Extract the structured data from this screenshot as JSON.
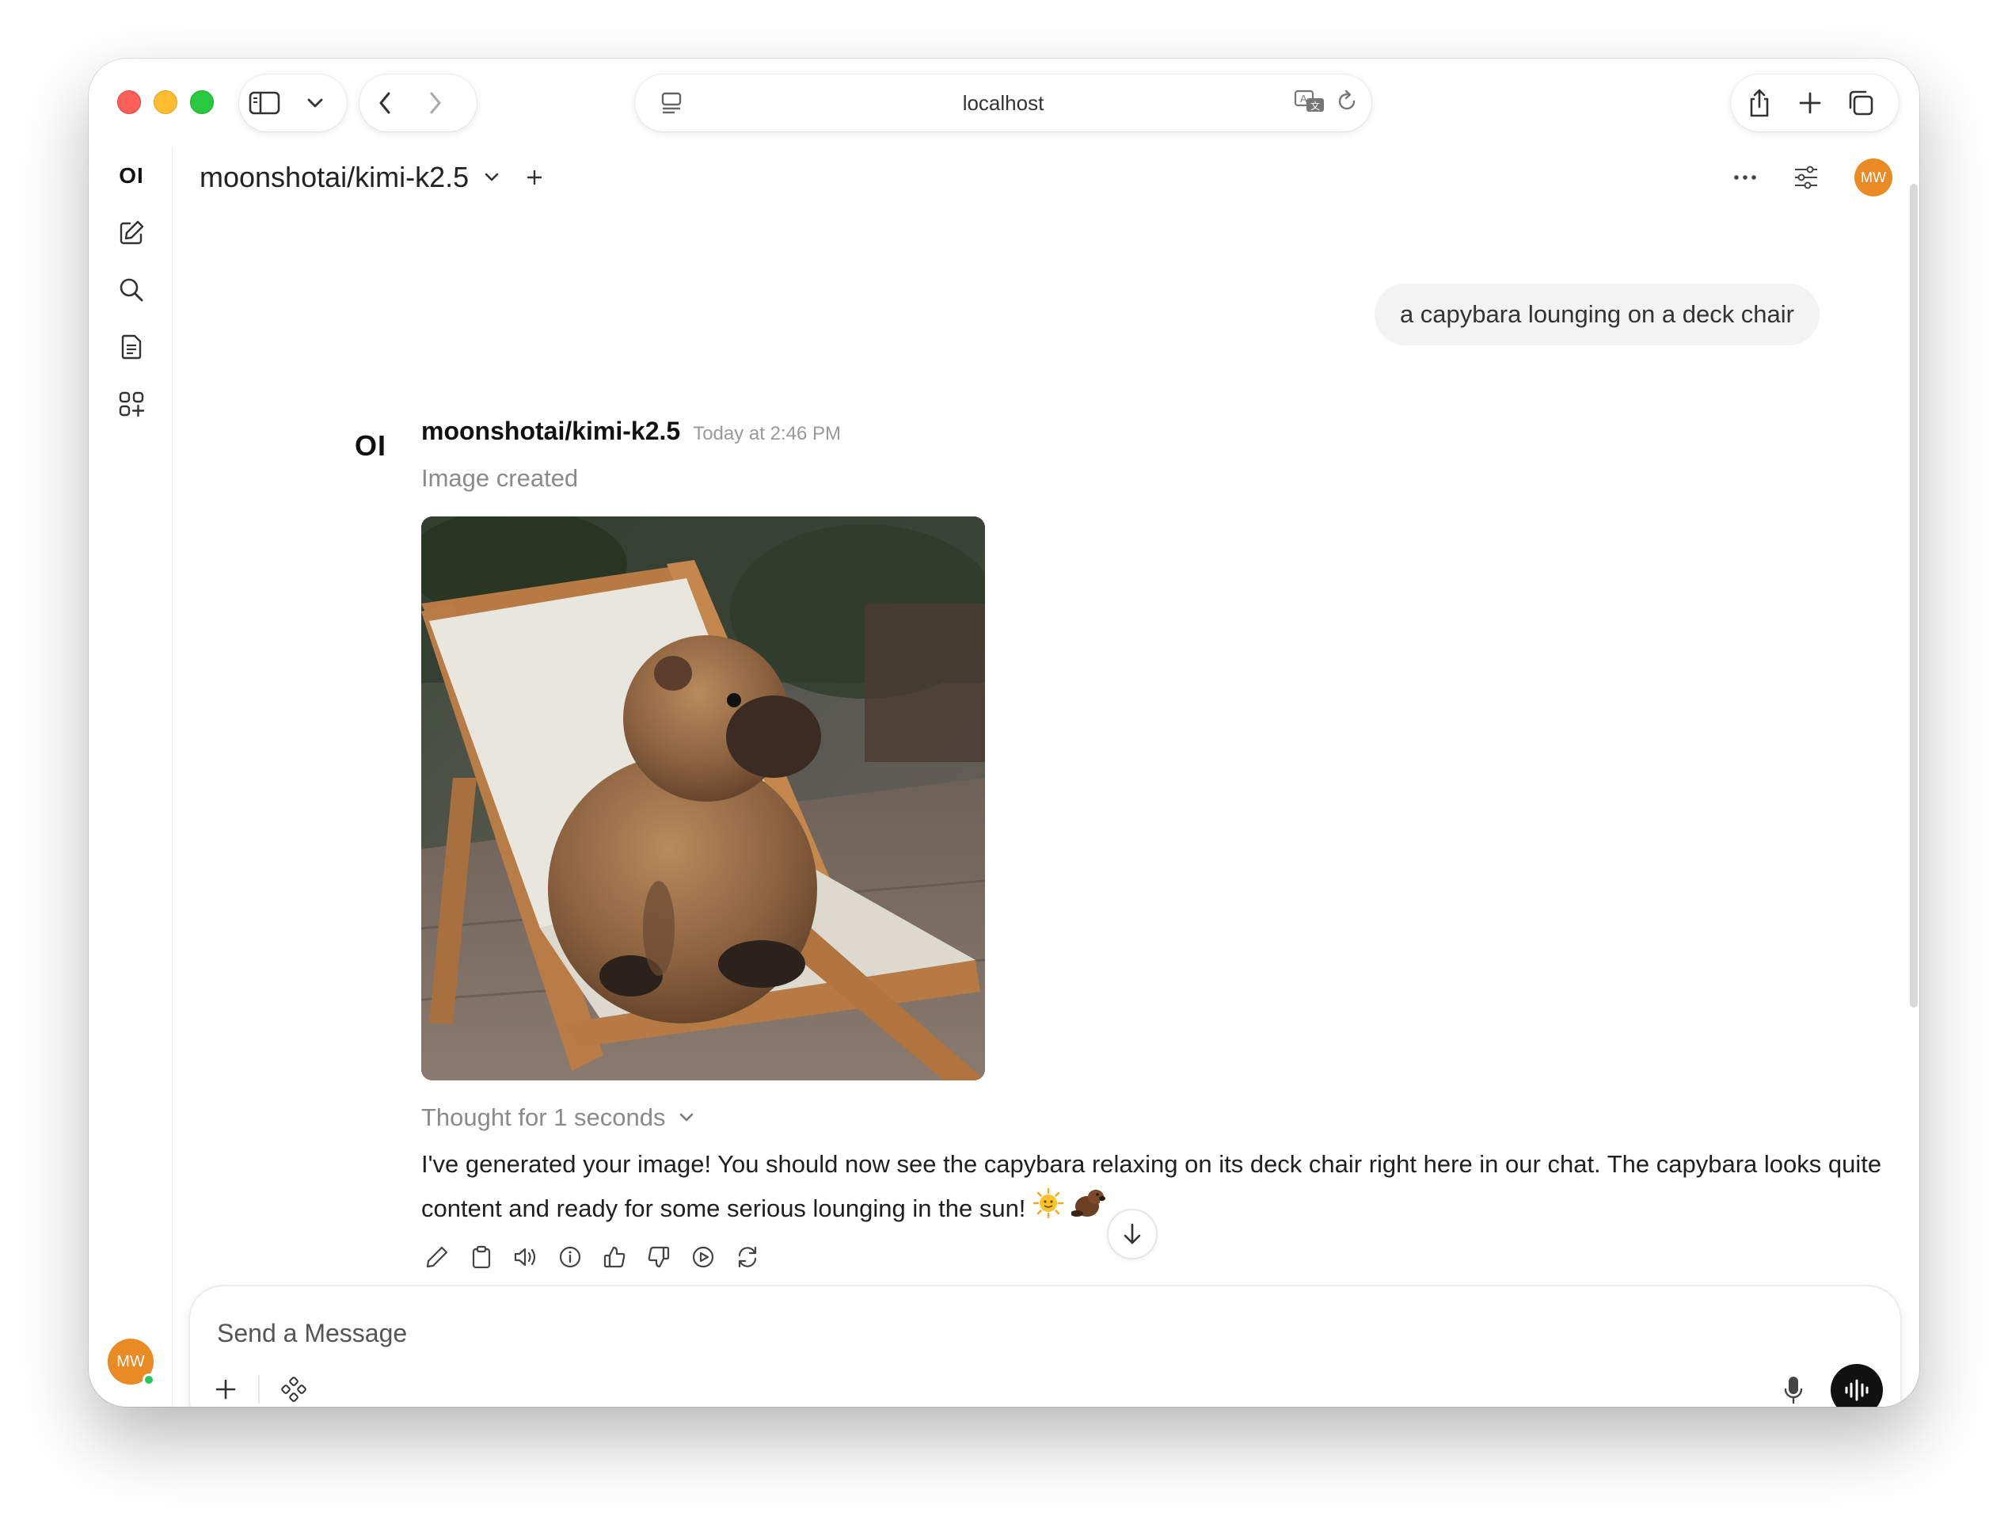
{
  "browser": {
    "url": "localhost"
  },
  "header": {
    "model_name": "moonshotai/kimi-k2.5",
    "avatar_initials": "MW"
  },
  "sidebar": {
    "logo": "OI",
    "items": [
      {
        "name": "new-chat",
        "icon": "pencil-square-icon"
      },
      {
        "name": "search",
        "icon": "search-icon"
      },
      {
        "name": "notes",
        "icon": "notes-icon"
      },
      {
        "name": "workspace",
        "icon": "grid-plus-icon"
      }
    ],
    "avatar_initials": "MW",
    "status": "online"
  },
  "chat": {
    "user_message": "a capybara lounging on a deck chair",
    "assistant": {
      "logo": "OI",
      "model": "moonshotai/kimi-k2.5",
      "timestamp": "Today at 2:46 PM",
      "status": "Image created",
      "image_subject": "capybara on a wooden deck chair",
      "thought": "Thought for 1 seconds",
      "text": "I've generated your image! You should now see the capybara relaxing on its deck chair right here in our chat. The capybara looks quite content and ready for some serious lounging in the sun!",
      "emojis": [
        "sun-face",
        "beaver"
      ],
      "actions": [
        "edit",
        "copy",
        "read-aloud",
        "info",
        "good-response",
        "bad-response",
        "continue",
        "regenerate"
      ]
    }
  },
  "composer": {
    "placeholder": "Send a Message"
  },
  "colors": {
    "avatar": "#e98a23",
    "online": "#22c55e",
    "user_bubble": "#f3f3f3",
    "voice_button": "#111111"
  }
}
